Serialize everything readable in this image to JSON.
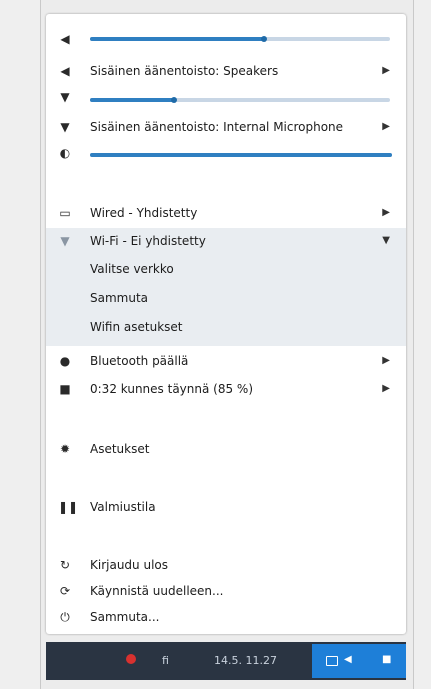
{
  "colors": {
    "accent": "#2f7fc1",
    "taskbar": "#2a3442",
    "tray": "#1e7fd8",
    "submenu_bg": "#e9edf1"
  },
  "audio": {
    "output_volume_percent": 58,
    "output_label": "Sisäinen äänentoisto: Speakers",
    "input_volume_percent": 28,
    "input_label": "Sisäinen äänentoisto: Internal Microphone",
    "brightness_percent": 100
  },
  "network": {
    "wired_label": "Wired - Yhdistetty",
    "wifi_label": "Wi-Fi - Ei yhdistetty",
    "wifi_submenu": [
      "Valitse verkko",
      "Sammuta",
      "Wifin asetukset"
    ]
  },
  "bluetooth_label": "Bluetooth päällä",
  "battery_label": "0:32 kunnes täynnä (85 %)",
  "settings_label": "Asetukset",
  "suspend_label": "Valmiustila",
  "logout_label": "Kirjaudu ulos",
  "restart_label": "Käynnistä uudelleen...",
  "shutdown_label": "Sammuta...",
  "taskbar": {
    "keyboard_layout": "fi",
    "datetime": "14.5. 11.27"
  },
  "icons": {
    "speaker": "speaker-icon",
    "mic": "microphone-icon",
    "brightness": "brightness-icon",
    "wired": "ethernet-icon",
    "wifi": "wifi-icon",
    "bluetooth": "bluetooth-icon",
    "battery": "battery-icon",
    "settings": "gear-icon",
    "suspend": "pause-icon",
    "logout": "logout-icon",
    "restart": "restart-icon",
    "shutdown": "power-icon"
  }
}
